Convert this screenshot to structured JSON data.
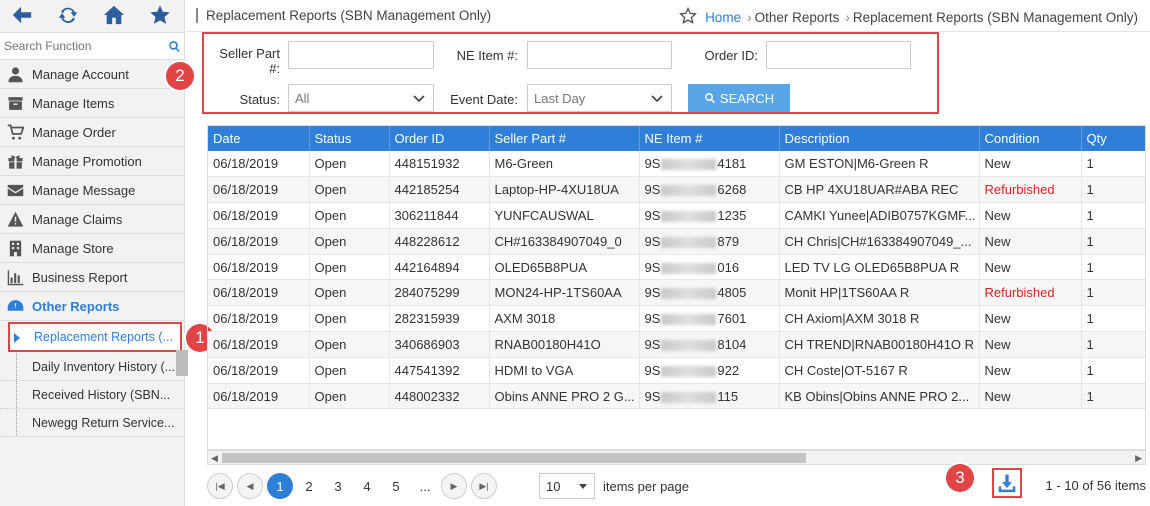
{
  "sidebar": {
    "search_placeholder": "Search Function",
    "menu": [
      {
        "label": "Manage Account",
        "icon": "user-icon"
      },
      {
        "label": "Manage Items",
        "icon": "box-icon"
      },
      {
        "label": "Manage Order",
        "icon": "cart-icon"
      },
      {
        "label": "Manage Promotion",
        "icon": "gift-icon"
      },
      {
        "label": "Manage Message",
        "icon": "envelope-icon"
      },
      {
        "label": "Manage Claims",
        "icon": "warning-icon"
      },
      {
        "label": "Manage Store",
        "icon": "building-icon"
      },
      {
        "label": "Business Report",
        "icon": "bar-chart-icon"
      },
      {
        "label": "Other Reports",
        "icon": "dashboard-icon"
      }
    ],
    "submenu": [
      {
        "label": "Replacement Reports (..."
      },
      {
        "label": "Daily Inventory History (..."
      },
      {
        "label": "Received History (SBN..."
      },
      {
        "label": "Newegg Return Service..."
      }
    ]
  },
  "header": {
    "title": "Replacement Reports (SBN Management Only)",
    "breadcrumb": {
      "home": "Home",
      "level2": "Other Reports",
      "current": "Replacement Reports (SBN Management Only)"
    }
  },
  "filters": {
    "seller_part_label_1": "Seller Part",
    "seller_part_label_2": "#:",
    "ne_item_label": "NE Item #:",
    "order_id_label": "Order ID:",
    "status_label": "Status:",
    "status_value": "All",
    "event_date_label": "Event Date:",
    "event_date_value": "Last Day",
    "search_label": "SEARCH"
  },
  "annotations": {
    "one": "1",
    "two": "2",
    "three": "3"
  },
  "table": {
    "columns": [
      "Date",
      "Status",
      "Order ID",
      "Seller Part #",
      "NE Item #",
      "Description",
      "Condition",
      "Qty"
    ],
    "rows": [
      {
        "date": "06/18/2019",
        "status": "Open",
        "order": "448151932",
        "part": "M6-Green",
        "ne_pre": "9S",
        "ne_suf": "4181",
        "desc": "GM ESTON|M6-Green R",
        "cond": "New",
        "qty": "1"
      },
      {
        "date": "06/18/2019",
        "status": "Open",
        "order": "442185254",
        "part": "Laptop-HP-4XU18UA",
        "ne_pre": "9S",
        "ne_suf": "6268",
        "desc": "CB HP 4XU18UAR#ABA REC",
        "cond": "Refurbished",
        "qty": "1"
      },
      {
        "date": "06/18/2019",
        "status": "Open",
        "order": "306211844",
        "part": "YUNFCAUSWAL",
        "ne_pre": "9S",
        "ne_suf": "1235",
        "desc": "CAMKI Yunee|ADIB0757KGMF...",
        "cond": "New",
        "qty": "1"
      },
      {
        "date": "06/18/2019",
        "status": "Open",
        "order": "448228612",
        "part": "CH#163384907049_0",
        "ne_pre": "9S",
        "ne_suf": "879",
        "desc": "CH Chris|CH#163384907049_...",
        "cond": "New",
        "qty": "1"
      },
      {
        "date": "06/18/2019",
        "status": "Open",
        "order": "442164894",
        "part": "OLED65B8PUA",
        "ne_pre": "9S",
        "ne_suf": "016",
        "desc": "LED TV LG OLED65B8PUA R",
        "cond": "New",
        "qty": "1"
      },
      {
        "date": "06/18/2019",
        "status": "Open",
        "order": "284075299",
        "part": "MON24-HP-1TS60AA",
        "ne_pre": "9S",
        "ne_suf": "4805",
        "desc": "Monit HP|1TS60AA R",
        "cond": "Refurbished",
        "qty": "1"
      },
      {
        "date": "06/18/2019",
        "status": "Open",
        "order": "282315939",
        "part": "AXM 3018",
        "ne_pre": "9S",
        "ne_suf": "7601",
        "desc": "CH Axiom|AXM 3018 R",
        "cond": "New",
        "qty": "1"
      },
      {
        "date": "06/18/2019",
        "status": "Open",
        "order": "340686903",
        "part": "RNAB00180H41O",
        "ne_pre": "9S",
        "ne_suf": "8104",
        "desc": "CH TREND|RNAB00180H41O R",
        "cond": "New",
        "qty": "1"
      },
      {
        "date": "06/18/2019",
        "status": "Open",
        "order": "447541392",
        "part": "HDMI to VGA",
        "ne_pre": "9S",
        "ne_suf": "922",
        "desc": "CH Coste|OT-5167 R",
        "cond": "New",
        "qty": "1"
      },
      {
        "date": "06/18/2019",
        "status": "Open",
        "order": "448002332",
        "part": "Obins ANNE PRO 2 G...",
        "ne_pre": "9S",
        "ne_suf": "115",
        "desc": "KB Obins|Obins ANNE PRO 2...",
        "cond": "New",
        "qty": "1"
      }
    ]
  },
  "pager": {
    "pages": [
      "1",
      "2",
      "3",
      "4",
      "5",
      "..."
    ],
    "current": "1",
    "page_size": "10",
    "items_per_page": "items per page",
    "summary": "1 - 10 of 56 items"
  },
  "colors": {
    "accent": "#2f7ed8",
    "annotation": "#e04444",
    "refurbished": "#e02020"
  }
}
